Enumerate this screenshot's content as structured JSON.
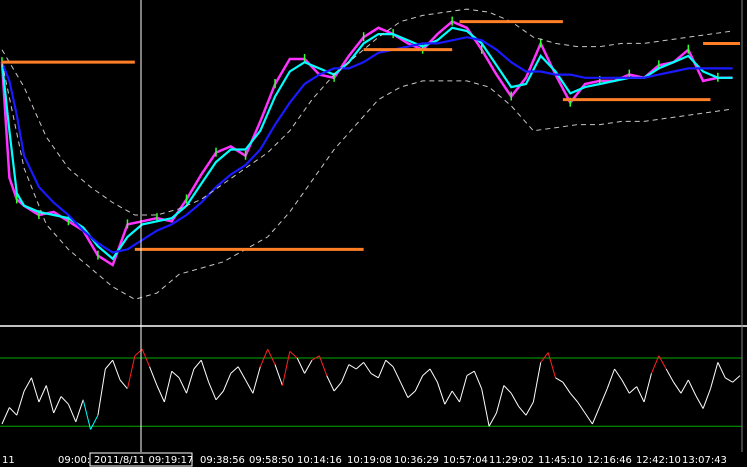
{
  "window": {
    "background": "#000000",
    "separator_color": "#c0c0c0",
    "right_scale_color": "#808080"
  },
  "cursor": {
    "label": "2011/8/11 09:19:17"
  },
  "time_axis": {
    "left_label": "11",
    "labels": [
      "09:00:0",
      "4",
      "09:38:56",
      "09:58:50",
      "10:14:16",
      "10:19:08",
      "10:36:29",
      "10:57:04",
      "11:29:02",
      "11:45:10",
      "12:16:46",
      "12:42:10",
      "13:07:43"
    ]
  },
  "chart_data": [
    {
      "type": "line",
      "panel": "price",
      "title": "",
      "xlabel": "",
      "ylabel": "",
      "x_units": "bar index",
      "xlim": [
        0,
        100
      ],
      "ylim": [
        0,
        100
      ],
      "grid": false,
      "series": [
        {
          "color": "#ff33ff",
          "style": "price-candles",
          "accent": "#33ff33",
          "x": [
            0,
            1,
            2,
            3,
            5,
            7,
            9,
            11,
            13,
            15,
            17,
            19,
            21,
            23,
            25,
            27,
            29,
            31,
            33,
            35,
            37,
            39,
            41,
            43,
            45,
            47,
            49,
            51,
            53,
            55,
            57,
            59,
            61,
            63,
            65,
            67,
            69,
            71,
            73,
            75,
            77,
            79,
            81,
            83,
            85,
            87,
            89,
            91,
            93,
            95,
            97,
            99
          ],
          "y": [
            82,
            45,
            38,
            36,
            33,
            34,
            31,
            28,
            20,
            17,
            30,
            31,
            32,
            31,
            38,
            46,
            53,
            55,
            52,
            63,
            75,
            83,
            83,
            78,
            77,
            84,
            90,
            93,
            91,
            88,
            86,
            91,
            95,
            93,
            86,
            78,
            71,
            77,
            88,
            78,
            69,
            75,
            76,
            76,
            78,
            77,
            81,
            82,
            86,
            76,
            77,
            77
          ]
        },
        {
          "color": "#00ffff",
          "x": [
            0,
            1,
            2,
            3,
            5,
            7,
            9,
            11,
            13,
            15,
            17,
            19,
            21,
            23,
            25,
            27,
            29,
            31,
            33,
            35,
            37,
            39,
            41,
            43,
            45,
            47,
            49,
            51,
            53,
            55,
            57,
            59,
            61,
            63,
            65,
            67,
            69,
            71,
            73,
            75,
            77,
            79,
            81,
            83,
            85,
            87,
            89,
            91,
            93,
            95,
            97,
            99
          ],
          "y": [
            82,
            60,
            40,
            36,
            34,
            33,
            32,
            29,
            23,
            19,
            26,
            30,
            31,
            32,
            36,
            43,
            50,
            54,
            54,
            60,
            71,
            79,
            82,
            80,
            78,
            82,
            88,
            91,
            91,
            89,
            87,
            89,
            93,
            92,
            88,
            81,
            74,
            75,
            84,
            79,
            72,
            74,
            75,
            76,
            77,
            77,
            80,
            82,
            84,
            79,
            77,
            77
          ]
        },
        {
          "color": "#1a1aff",
          "x": [
            0,
            1,
            2,
            3,
            5,
            7,
            9,
            11,
            13,
            15,
            17,
            19,
            21,
            23,
            25,
            27,
            29,
            31,
            33,
            35,
            37,
            39,
            41,
            43,
            45,
            47,
            49,
            51,
            53,
            55,
            57,
            59,
            61,
            63,
            65,
            67,
            69,
            71,
            73,
            75,
            77,
            79,
            81,
            83,
            85,
            87,
            89,
            91,
            93,
            95,
            97,
            99
          ],
          "y": [
            82,
            76,
            65,
            52,
            42,
            37,
            33,
            28,
            24,
            21,
            22,
            25,
            28,
            30,
            33,
            37,
            42,
            46,
            49,
            54,
            62,
            69,
            75,
            78,
            80,
            80,
            82,
            85,
            86,
            87,
            88,
            88,
            89,
            90,
            89,
            86,
            82,
            79,
            79,
            78,
            78,
            77,
            77,
            77,
            77,
            77,
            78,
            79,
            80,
            80,
            80,
            80
          ]
        },
        {
          "color": "#c8c8c8",
          "style": "dashed",
          "x": [
            0,
            3,
            6,
            9,
            12,
            15,
            18,
            21,
            24,
            27,
            30,
            33,
            36,
            39,
            42,
            45,
            48,
            51,
            54,
            57,
            60,
            63,
            66,
            69,
            72,
            75,
            78,
            81,
            84,
            87,
            90,
            93,
            96,
            99
          ],
          "y": [
            86,
            74,
            58,
            48,
            42,
            37,
            33,
            33,
            35,
            38,
            43,
            48,
            53,
            60,
            70,
            78,
            84,
            90,
            95,
            97,
            98,
            99,
            98,
            95,
            90,
            88,
            87,
            87,
            88,
            88,
            89,
            90,
            91,
            92
          ]
        },
        {
          "color": "#c8c8c8",
          "style": "dashed",
          "x": [
            0,
            3,
            6,
            9,
            12,
            15,
            18,
            21,
            24,
            27,
            30,
            33,
            36,
            39,
            42,
            45,
            48,
            51,
            54,
            57,
            60,
            63,
            66,
            69,
            72,
            75,
            78,
            81,
            84,
            87,
            90,
            93,
            96,
            99
          ],
          "y": [
            82,
            48,
            30,
            22,
            16,
            10,
            6,
            8,
            14,
            16,
            18,
            22,
            26,
            34,
            44,
            54,
            62,
            70,
            74,
            76,
            76,
            76,
            74,
            68,
            60,
            61,
            62,
            62,
            63,
            63,
            64,
            65,
            66,
            67
          ]
        },
        {
          "color": "#ff7f27",
          "style": "level",
          "x": [
            0,
            18
          ],
          "y": [
            82,
            82
          ]
        },
        {
          "color": "#ff7f27",
          "style": "level",
          "x": [
            18,
            49
          ],
          "y": [
            22,
            22
          ]
        },
        {
          "color": "#ff7f27",
          "style": "level",
          "x": [
            49,
            61
          ],
          "y": [
            86,
            86
          ]
        },
        {
          "color": "#ff7f27",
          "style": "level",
          "x": [
            62,
            76
          ],
          "y": [
            95,
            95
          ]
        },
        {
          "color": "#ff7f27",
          "style": "level",
          "x": [
            76,
            96
          ],
          "y": [
            70,
            70
          ]
        },
        {
          "color": "#ff7f27",
          "style": "level",
          "x": [
            95,
            100
          ],
          "y": [
            88,
            88
          ]
        }
      ]
    },
    {
      "type": "line",
      "panel": "oscillator",
      "title": "",
      "xlabel": "",
      "ylabel": "",
      "x_units": "bar index",
      "xlim": [
        0,
        100
      ],
      "ylim": [
        0,
        100
      ],
      "grid": false,
      "levels": [
        {
          "value": 80,
          "color": "#00aa00"
        },
        {
          "value": 18,
          "color": "#00aa00"
        }
      ],
      "colors": {
        "normal": "#ffffff",
        "high": "#ff2020",
        "low": "#00ffff"
      },
      "series": [
        {
          "color": "#ffffff",
          "x": [
            0,
            1,
            2,
            3,
            4,
            5,
            6,
            7,
            8,
            9,
            10,
            11,
            12,
            13,
            14,
            15,
            16,
            17,
            18,
            19,
            20,
            21,
            22,
            23,
            24,
            25,
            26,
            27,
            28,
            29,
            30,
            31,
            32,
            33,
            34,
            35,
            36,
            37,
            38,
            39,
            40,
            41,
            42,
            43,
            44,
            45,
            46,
            47,
            48,
            49,
            50,
            51,
            52,
            53,
            54,
            55,
            56,
            57,
            58,
            59,
            60,
            61,
            62,
            63,
            64,
            65,
            66,
            67,
            68,
            69,
            70,
            71,
            72,
            73,
            74,
            75,
            76,
            77,
            78,
            79,
            80,
            81,
            82,
            83,
            84,
            85,
            86,
            87,
            88,
            89,
            90,
            91,
            92,
            93,
            94,
            95,
            96,
            97,
            98,
            99,
            100
          ],
          "y": [
            20,
            35,
            28,
            50,
            62,
            40,
            55,
            30,
            45,
            38,
            22,
            42,
            15,
            28,
            70,
            78,
            60,
            52,
            82,
            88,
            72,
            55,
            40,
            68,
            62,
            48,
            70,
            78,
            58,
            42,
            50,
            66,
            72,
            60,
            48,
            72,
            88,
            74,
            55,
            86,
            80,
            66,
            78,
            82,
            64,
            50,
            58,
            74,
            70,
            76,
            66,
            62,
            78,
            72,
            58,
            44,
            50,
            64,
            70,
            58,
            38,
            50,
            40,
            64,
            68,
            52,
            18,
            30,
            55,
            48,
            36,
            28,
            40,
            76,
            85,
            62,
            58,
            48,
            40,
            30,
            20,
            36,
            52,
            70,
            60,
            48,
            54,
            40,
            66,
            82,
            70,
            58,
            48,
            60,
            46,
            34,
            52,
            76,
            62,
            58,
            64
          ]
        }
      ]
    }
  ]
}
